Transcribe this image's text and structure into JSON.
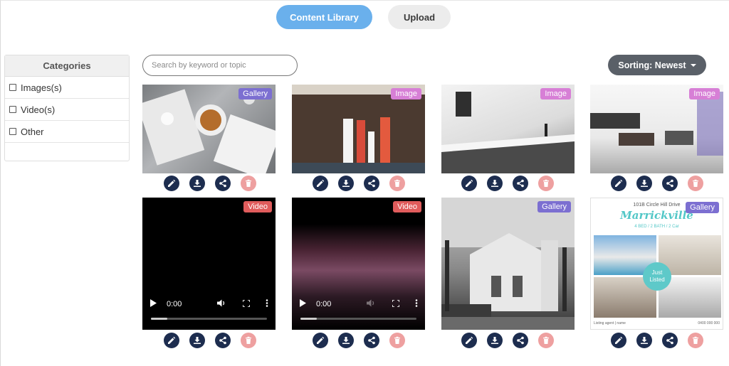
{
  "tabs": {
    "active": "Content Library",
    "inactive": "Upload"
  },
  "categories": {
    "title": "Categories",
    "items": [
      "Images(s)",
      "Video(s)",
      "Other"
    ]
  },
  "search": {
    "placeholder": "Search by keyword or topic"
  },
  "sort": {
    "label": "Sorting: Newest"
  },
  "colors": {
    "accent": "#6ab0ec",
    "action": "#1d2d4f",
    "delete": "#eea0a0",
    "gallery": "#7c6fd1",
    "image": "#d77fd6",
    "video": "#e05c5c"
  },
  "cards": [
    {
      "type": "Gallery"
    },
    {
      "type": "Image"
    },
    {
      "type": "Image"
    },
    {
      "type": "Image"
    },
    {
      "type": "Video",
      "time": "0:00"
    },
    {
      "type": "Video",
      "time": "0:00"
    },
    {
      "type": "Gallery"
    },
    {
      "type": "Gallery",
      "flyer": {
        "address": "101B Circle Hill Drive",
        "suburb": "Marrickville",
        "specs": "4 BED / 2 BATH / 2 Car",
        "tag": "Just Listed",
        "agent": "Listing agent | name",
        "phone": "0400 000 000"
      }
    }
  ],
  "action_icons": [
    "edit-icon",
    "download-icon",
    "share-icon",
    "trash-icon"
  ]
}
